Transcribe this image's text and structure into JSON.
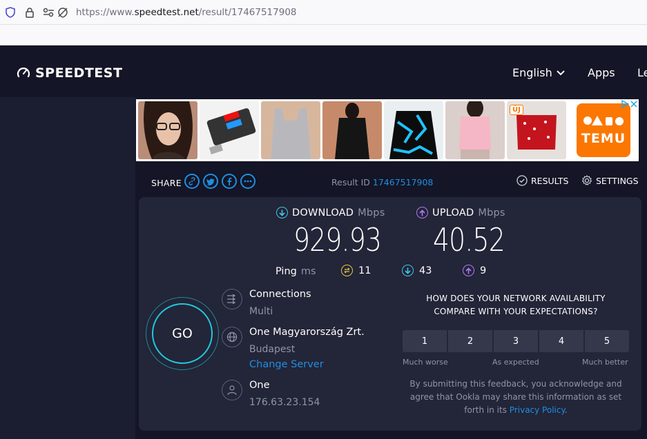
{
  "browser": {
    "url_prefix": "https://www.",
    "url_host": "speedtest.net",
    "url_path": "/result/17467517908"
  },
  "header": {
    "logo_text": "SPEEDTEST",
    "nav": {
      "language": "English",
      "apps": "Apps",
      "learn": "Le"
    }
  },
  "ad": {
    "badge": "ÚJ",
    "brand": "TEMU"
  },
  "share": {
    "label": "SHARE",
    "result_id_label": "Result ID",
    "result_id": "17467517908",
    "results_label": "RESULTS",
    "settings_label": "SETTINGS"
  },
  "result": {
    "download": {
      "label": "DOWNLOAD",
      "unit": "Mbps",
      "value": "929.93"
    },
    "upload": {
      "label": "UPLOAD",
      "unit": "Mbps",
      "value": "40.52"
    },
    "ping": {
      "label": "Ping",
      "unit": "ms",
      "idle": "11",
      "download": "43",
      "upload": "9"
    },
    "go_label": "GO",
    "connections": {
      "title": "Connections",
      "value": "Multi"
    },
    "server": {
      "name": "One Magyarország Zrt.",
      "city": "Budapest",
      "change": "Change Server"
    },
    "isp": {
      "name": "One",
      "ip": "176.63.23.154"
    }
  },
  "survey": {
    "question_line1": "HOW DOES YOUR NETWORK AVAILABILITY",
    "question_line2": "COMPARE WITH YOUR EXPECTATIONS?",
    "options": [
      "1",
      "2",
      "3",
      "4",
      "5"
    ],
    "low_label": "Much worse",
    "mid_label": "As expected",
    "high_label": "Much better",
    "disclaimer_line1": "By submitting this feedback, you acknowledge and",
    "disclaimer_line2": "agree that Ookla may share this information as set",
    "disclaimer_line3_prefix": "forth in its",
    "privacy_link": "Privacy Policy",
    "disclaimer_suffix": "."
  },
  "colors": {
    "background": "#141526",
    "panel": "#232538",
    "accent_blue": "#1f8fe0",
    "download_cyan": "#3fc8e6",
    "upload_purple": "#b07af5",
    "ping_yellow": "#e8c93a",
    "temu_orange": "#fb7701"
  }
}
